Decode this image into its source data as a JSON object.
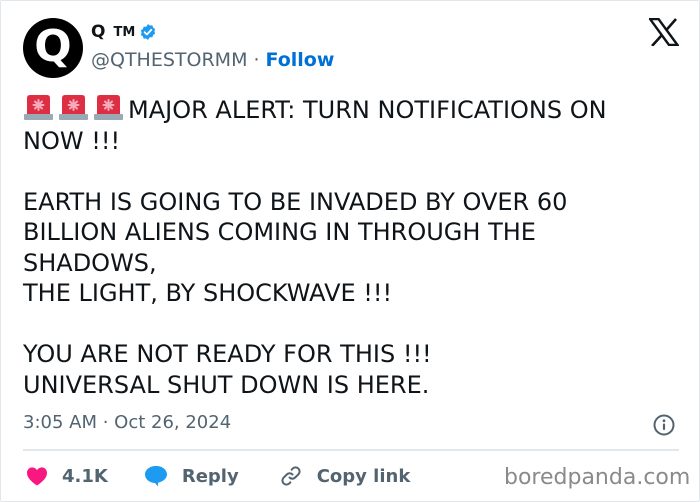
{
  "author": {
    "avatar_letter": "Q",
    "display_name": "Q",
    "trademark": "TM",
    "verified": true,
    "handle": "@QTHESTORMM",
    "separator": "·",
    "follow_label": "Follow"
  },
  "tweet": {
    "line1": "MAJOR ALERT: TURN NOTIFICATIONS ON NOW !!!",
    "body": "\n\nEARTH IS GOING TO BE INVADED BY OVER 60 BILLION ALIENS COMING IN THROUGH THE SHADOWS,\nTHE LIGHT, BY SHOCKWAVE !!!\n\nYOU ARE NOT READY FOR THIS !!!\nUNIVERSAL SHUT DOWN IS HERE.",
    "emoji_icons": [
      "police-siren-icon",
      "police-siren-icon",
      "police-siren-icon"
    ],
    "timestamp": "3:05 AM · Oct 26, 2024"
  },
  "actions": {
    "like_count": "4.1K",
    "reply_label": "Reply",
    "copy_link_label": "Copy link"
  },
  "watermark": "boredpanda.com",
  "colors": {
    "follow": "#006fd6",
    "like": "#f91880",
    "reply": "#1d9bf0",
    "verified": "#1d9bf0",
    "secondary_text": "#536471"
  }
}
